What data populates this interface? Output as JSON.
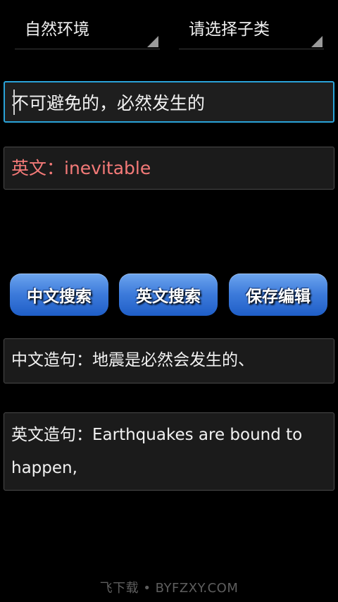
{
  "spinners": {
    "category": "自然环境",
    "subcategory": "请选择子类"
  },
  "input": {
    "chinese_value": "不可避免的，必然发生的"
  },
  "result": {
    "english": "英文：inevitable"
  },
  "buttons": {
    "chinese_search": "中文搜索",
    "english_search": "英文搜索",
    "save_edit": "保存编辑"
  },
  "sentences": {
    "chinese": "中文造句：地震是必然会发生的、",
    "english": "英文造句：Earthquakes are bound to happen,"
  },
  "watermark": "飞下载 • BYFZXY.COM",
  "colors": {
    "accent_focus": "#2aa3d9",
    "result_text": "#f47a78",
    "button_blue": "#3d7bdb"
  }
}
